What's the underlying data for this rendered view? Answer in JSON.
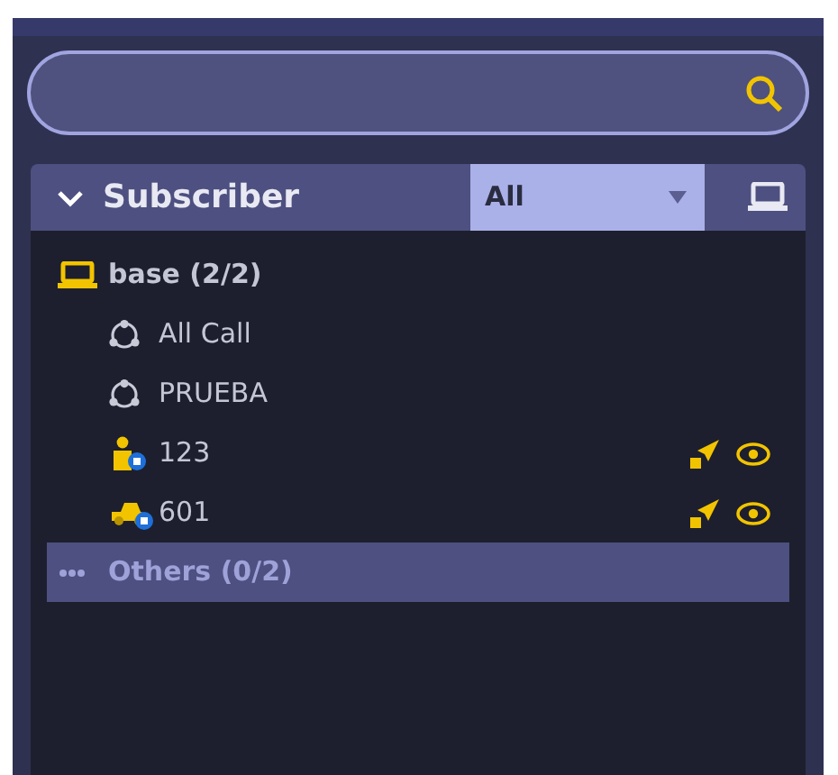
{
  "header": {
    "title": "Subscriber",
    "expanded": true,
    "filter": "All"
  },
  "tree": [
    {
      "kind": "group",
      "label": "base (2/2)",
      "selected": false,
      "children": [
        {
          "kind": "talkgroup",
          "label": "All Call",
          "selected": false,
          "actions": false
        },
        {
          "kind": "talkgroup",
          "label": "PRUEBA",
          "selected": false,
          "actions": false
        },
        {
          "kind": "user",
          "label": "123",
          "selected": false,
          "actions": true
        },
        {
          "kind": "vehicle",
          "label": "601",
          "selected": false,
          "actions": true
        }
      ]
    },
    {
      "kind": "other",
      "label": "Others (0/2)",
      "selected": true
    }
  ]
}
